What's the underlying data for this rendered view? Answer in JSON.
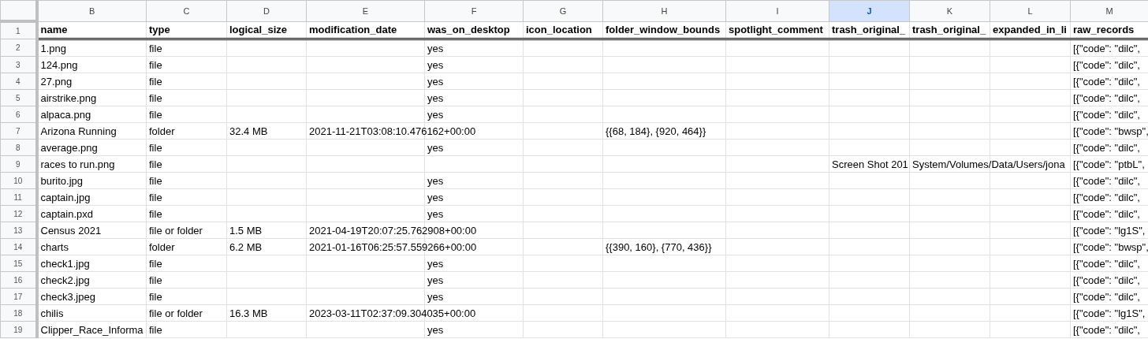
{
  "spreadsheet": {
    "columns": [
      {
        "letter": "B",
        "selected": false
      },
      {
        "letter": "C",
        "selected": false
      },
      {
        "letter": "D",
        "selected": false
      },
      {
        "letter": "E",
        "selected": false
      },
      {
        "letter": "F",
        "selected": false
      },
      {
        "letter": "G",
        "selected": false
      },
      {
        "letter": "H",
        "selected": false
      },
      {
        "letter": "I",
        "selected": false
      },
      {
        "letter": "J",
        "selected": true
      },
      {
        "letter": "K",
        "selected": false
      },
      {
        "letter": "L",
        "selected": false
      },
      {
        "letter": "M",
        "selected": false
      }
    ],
    "header_row": {
      "number": "1",
      "cells": {
        "B": "name",
        "C": "type",
        "D": "logical_size",
        "E": "modification_date",
        "F": "was_on_desktop",
        "G": "icon_location",
        "H": "folder_window_bounds",
        "I": "spotlight_comment",
        "J": "trash_original_",
        "K": "trash_original_",
        "L": "expanded_in_li",
        "M": "raw_records"
      }
    },
    "rows": [
      {
        "number": "2",
        "cells": {
          "B": "1.png",
          "C": "file",
          "F": "yes",
          "M": "[{\"code\": \"dilc\","
        }
      },
      {
        "number": "3",
        "cells": {
          "B": "124.png",
          "C": "file",
          "F": "yes",
          "M": "[{\"code\": \"dilc\","
        }
      },
      {
        "number": "4",
        "cells": {
          "B": "27.png",
          "C": "file",
          "F": "yes",
          "M": "[{\"code\": \"dilc\","
        }
      },
      {
        "number": "5",
        "cells": {
          "B": "airstrike.png",
          "C": "file",
          "F": "yes",
          "M": "[{\"code\": \"dilc\","
        }
      },
      {
        "number": "6",
        "cells": {
          "B": "alpaca.png",
          "C": "file",
          "F": "yes",
          "M": "[{\"code\": \"dilc\","
        }
      },
      {
        "number": "7",
        "cells": {
          "B": "Arizona Running",
          "C": "folder",
          "D": "32.4 MB",
          "E": "2021-11-21T03:08:10.476162+00:00",
          "H": "{{68, 184}, {920, 464}}",
          "M": "[{\"code\": \"bwsp\","
        }
      },
      {
        "number": "8",
        "cells": {
          "B": "average.png",
          "C": "file",
          "F": "yes",
          "M": "[{\"code\": \"dilc\","
        }
      },
      {
        "number": "9",
        "cells": {
          "B": "races to run.png",
          "C": "file",
          "J": "Screen Shot 201",
          "K": "System/Volumes/Data/Users/jona",
          "M": "[{\"code\": \"ptbL\","
        }
      },
      {
        "number": "10",
        "cells": {
          "B": "burito.jpg",
          "C": "file",
          "F": "yes",
          "M": "[{\"code\": \"dilc\","
        }
      },
      {
        "number": "11",
        "cells": {
          "B": "captain.jpg",
          "C": "file",
          "F": "yes",
          "M": "[{\"code\": \"dilc\","
        }
      },
      {
        "number": "12",
        "cells": {
          "B": "captain.pxd",
          "C": "file",
          "F": "yes",
          "M": "[{\"code\": \"dilc\","
        }
      },
      {
        "number": "13",
        "cells": {
          "B": "Census 2021",
          "C": "file or folder",
          "D": "1.5 MB",
          "E": "2021-04-19T20:07:25.762908+00:00",
          "M": "[{\"code\": \"lg1S\","
        }
      },
      {
        "number": "14",
        "cells": {
          "B": "charts",
          "C": "folder",
          "D": "6.2 MB",
          "E": "2021-01-16T06:25:57.559266+00:00",
          "H": "{{390, 160}, {770, 436}}",
          "M": "[{\"code\": \"bwsp\","
        }
      },
      {
        "number": "15",
        "cells": {
          "B": "check1.jpg",
          "C": "file",
          "F": "yes",
          "M": "[{\"code\": \"dilc\","
        }
      },
      {
        "number": "16",
        "cells": {
          "B": "check2.jpg",
          "C": "file",
          "F": "yes",
          "M": "[{\"code\": \"dilc\","
        }
      },
      {
        "number": "17",
        "cells": {
          "B": "check3.jpeg",
          "C": "file",
          "F": "yes",
          "M": "[{\"code\": \"dilc\","
        }
      },
      {
        "number": "18",
        "cells": {
          "B": "chilis",
          "C": "file or folder",
          "D": "16.3 MB",
          "E": "2023-03-11T02:37:09.304035+00:00",
          "M": "[{\"code\": \"lg1S\","
        }
      },
      {
        "number": "19",
        "cells": {
          "B": "Clipper_Race_Informa",
          "C": "file",
          "F": "yes",
          "M": "[{\"code\": \"dilc\","
        }
      }
    ]
  }
}
